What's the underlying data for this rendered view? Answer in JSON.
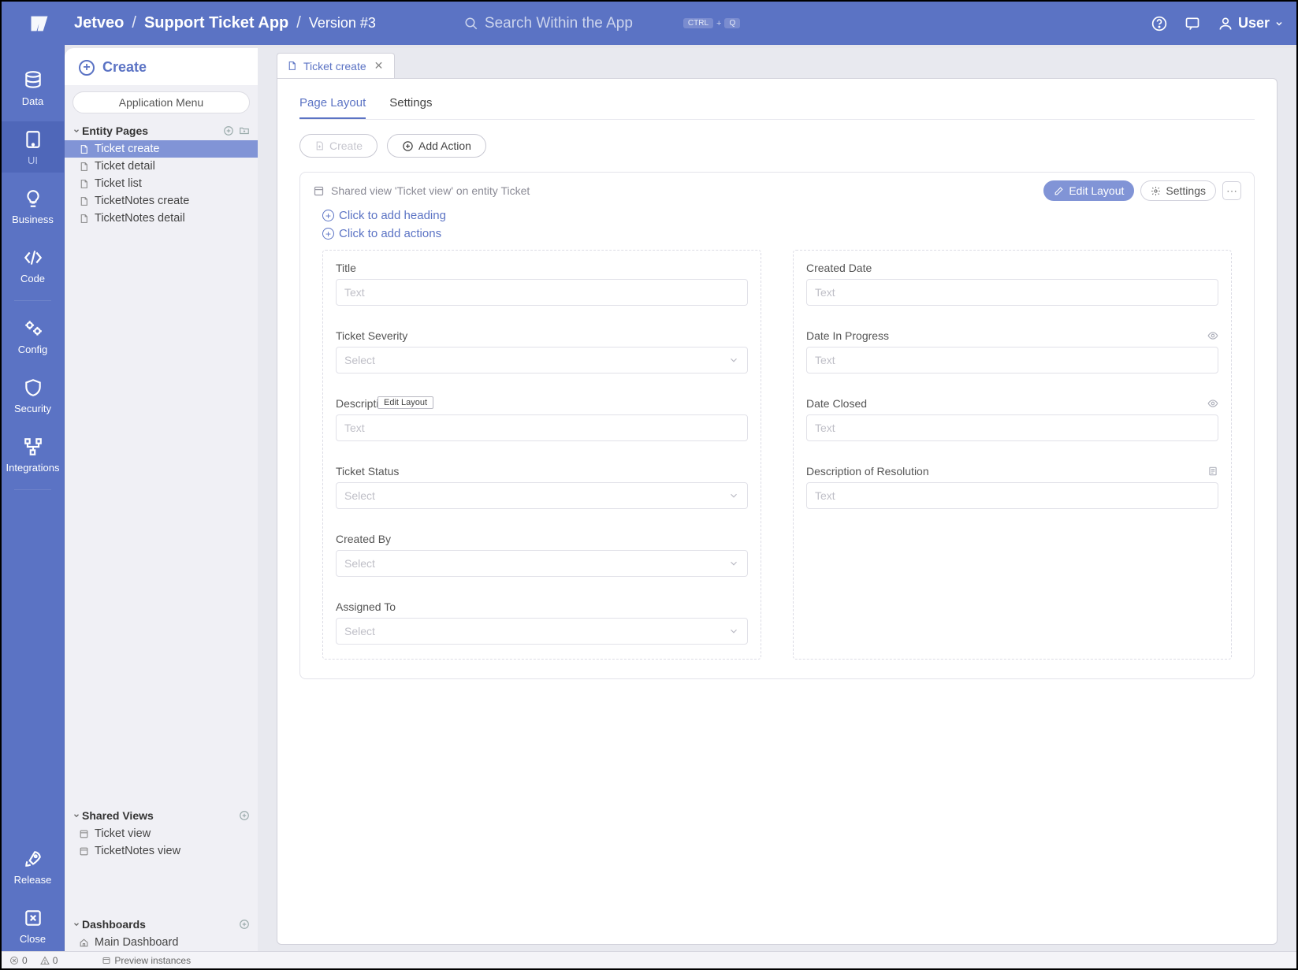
{
  "topbar": {
    "breadcrumbs": [
      "Jetveo",
      "Support Ticket App"
    ],
    "version": "Version #3",
    "search_placeholder": "Search Within the App",
    "kbd": [
      "CTRL",
      "Q"
    ],
    "user": "User"
  },
  "iconnav": [
    {
      "id": "data",
      "label": "Data"
    },
    {
      "id": "ui",
      "label": "UI"
    },
    {
      "id": "business",
      "label": "Business"
    },
    {
      "id": "code",
      "label": "Code"
    },
    {
      "id": "config",
      "label": "Config"
    },
    {
      "id": "security",
      "label": "Security"
    },
    {
      "id": "integrations",
      "label": "Integrations"
    },
    {
      "id": "release",
      "label": "Release"
    },
    {
      "id": "close",
      "label": "Close"
    }
  ],
  "sidepanel": {
    "create": "Create",
    "app_menu": "Application Menu",
    "groups": {
      "entity": {
        "title": "Entity Pages",
        "items": [
          "Ticket create",
          "Ticket detail",
          "Ticket list",
          "TicketNotes create",
          "TicketNotes detail"
        ]
      },
      "shared": {
        "title": "Shared Views",
        "items": [
          "Ticket view",
          "TicketNotes view"
        ]
      },
      "dashboards": {
        "title": "Dashboards",
        "items": [
          "Main Dashboard"
        ]
      }
    }
  },
  "tab": {
    "label": "Ticket create"
  },
  "innertabs": {
    "page_layout": "Page Layout",
    "settings": "Settings"
  },
  "actions": {
    "create": "Create",
    "add_action": "Add Action"
  },
  "layout_box": {
    "header": "Shared view 'Ticket view' on entity Ticket",
    "edit_layout": "Edit Layout",
    "settings": "Settings",
    "add_heading": "Click to add heading",
    "add_actions": "Click to add actions"
  },
  "tooltip": "Edit Layout",
  "placeholders": {
    "text": "Text",
    "select": "Select"
  },
  "fields": {
    "left": [
      {
        "label": "Title",
        "type": "text"
      },
      {
        "label": "Ticket Severity",
        "type": "select"
      },
      {
        "label": "Description",
        "type": "text"
      },
      {
        "label": "Ticket Status",
        "type": "select"
      },
      {
        "label": "Created By",
        "type": "select"
      },
      {
        "label": "Assigned To",
        "type": "select"
      }
    ],
    "right": [
      {
        "label": "Created Date",
        "type": "text",
        "icon": null
      },
      {
        "label": "Date In Progress",
        "type": "text",
        "icon": "eye"
      },
      {
        "label": "Date Closed",
        "type": "text",
        "icon": "eye"
      },
      {
        "label": "Description of Resolution",
        "type": "text",
        "icon": "note"
      }
    ]
  },
  "footer": {
    "errors": "0",
    "warnings": "0",
    "preview": "Preview instances"
  }
}
